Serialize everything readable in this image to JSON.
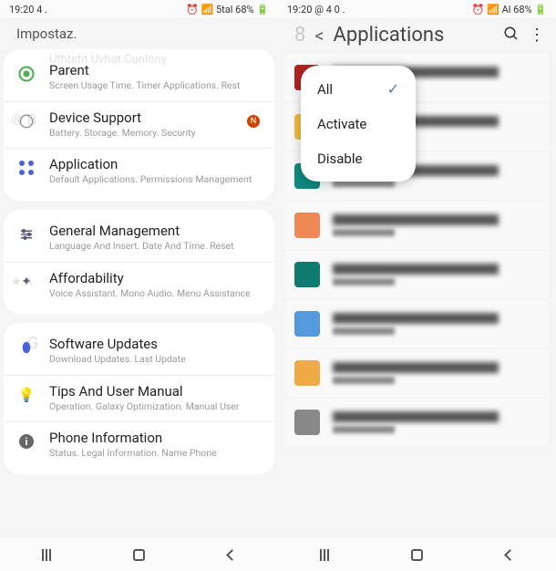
{
  "left": {
    "status": {
      "time": "19:20 4 .",
      "right": "⏰ 📶 5tal 68% 🔋"
    },
    "header": "Impostaz.",
    "groups": [
      {
        "items": [
          {
            "icon": "parent",
            "title": "Parent",
            "sub": "Screen Usage Time. Timer Applications. Rest",
            "ghost": "Uthtstit Uvhat Cunlony"
          },
          {
            "icon": "device",
            "title": "Device Support",
            "sub": "Battery. Storage. Memory. Security",
            "badge": "N",
            "ghost_left": "® B"
          },
          {
            "icon": "apps",
            "title": "Application",
            "sub": "Default Applications. Permissions Management"
          }
        ]
      },
      {
        "items": [
          {
            "icon": "sliders",
            "title": "General Management",
            "sub": "Language And Insert. Date And Time. Reset"
          },
          {
            "icon": "star",
            "title": "Affordability",
            "sub": "Voice Assistant. Mono Audio. Menu Assistance",
            "ghost_left": "★ A"
          }
        ]
      },
      {
        "items": [
          {
            "icon": "galaxy",
            "title": "Software Updates",
            "sub": "Download Updates. Last Update",
            "ghost_left": "G"
          },
          {
            "icon": "bulb",
            "title": "Tips And User Manual",
            "sub": "Operation. Galaxy Optimization. Manual User"
          },
          {
            "icon": "info",
            "title": "Phone Information",
            "sub": "Status. Legal Information. Name Phone"
          }
        ]
      }
    ]
  },
  "right": {
    "status": {
      "time": "19:20 @ 4 0 .",
      "right": "⏰ 📶 Al 68% 🔋"
    },
    "header": {
      "back": "<",
      "prefix": "8",
      "title": "Applications"
    },
    "dropdown": {
      "all": "All",
      "activate": "Activate",
      "disable": "Disable"
    },
    "apps": [
      {
        "color": "#b22222"
      },
      {
        "color": "#f4b942"
      },
      {
        "color": "#0f8a7e"
      },
      {
        "color": "#ee8855"
      },
      {
        "color": "#0f7a70"
      },
      {
        "color": "#5599dd"
      },
      {
        "color": "#eeaa44"
      },
      {
        "color": "#888888"
      }
    ]
  }
}
